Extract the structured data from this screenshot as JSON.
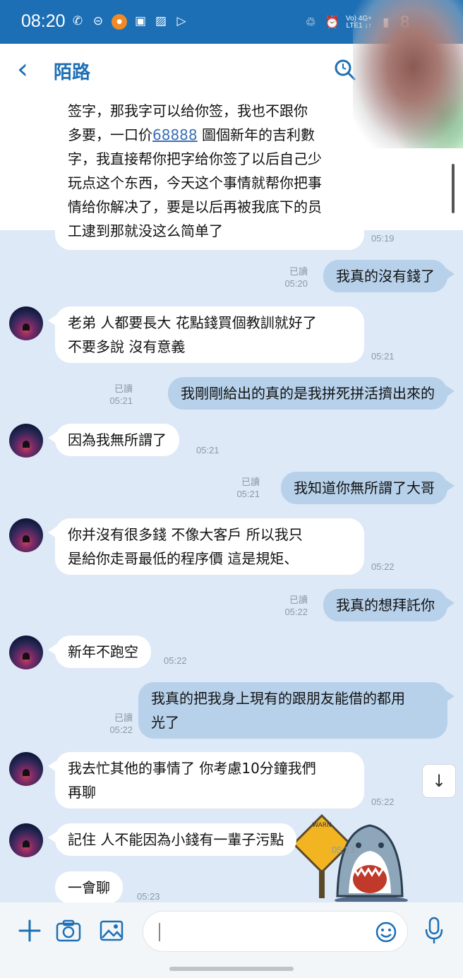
{
  "status_bar": {
    "time": "08:20",
    "net_top": "Vo) 4G+",
    "net_bottom": "LTE1 ↓↑",
    "battery": "8"
  },
  "header": {
    "title": "陌路"
  },
  "messages": [
    {
      "dir": "in",
      "text_lines": [
        "签字，那我字可以给你签，我也不跟你",
        "多要，一口价",
        "圖個新年的吉利數",
        "字，我直接帮你把字给你签了以后自己少",
        "玩点这个东西，今天这个事情就帮你把事",
        "情给你解决了，要是以后再被我底下的员",
        "工逮到那就没这么简单了"
      ],
      "link": "68888",
      "time": "05:19"
    },
    {
      "dir": "out",
      "text": "我真的沒有錢了",
      "read": "已讀",
      "time": "05:20"
    },
    {
      "dir": "in",
      "text_lines": [
        "老弟 人都要長大 花點錢買個教訓就好了",
        "不要多說 沒有意義"
      ],
      "time": "05:21"
    },
    {
      "dir": "out",
      "text": "我剛剛給出的真的是我拼死拼活擠出來的",
      "read": "已讀",
      "time": "05:21"
    },
    {
      "dir": "in",
      "text": "因為我無所謂了",
      "time": "05:21"
    },
    {
      "dir": "out",
      "text": "我知道你無所謂了大哥",
      "read": "已讀",
      "time": "05:21"
    },
    {
      "dir": "in",
      "text_lines": [
        "你并沒有很多錢  不像大客戶  所以我只",
        "是給你走哥最低的程序價  這是規矩、"
      ],
      "time": "05:22"
    },
    {
      "dir": "out",
      "text": "我真的想拜託你",
      "read": "已讀",
      "time": "05:22"
    },
    {
      "dir": "in",
      "text": "新年不跑空",
      "time": "05:22"
    },
    {
      "dir": "out",
      "text_lines": [
        "我真的把我身上現有的跟朋友能借的都用",
        "光了"
      ],
      "read": "已讀",
      "time": "05:22"
    },
    {
      "dir": "in",
      "text_lines": [
        "我去忙其他的事情了 你考慮10分鐘我們",
        "再聊"
      ],
      "time": "05:22"
    },
    {
      "dir": "in",
      "text": "記住  人不能因為小錢有一輩子污點",
      "time": "05:23"
    },
    {
      "dir": "in",
      "text": "一會聊",
      "time": "05:23"
    }
  ],
  "sticker": {
    "sign_text": "WARN",
    "icon": "shark-warning-sticker"
  },
  "icons": [
    "back-icon",
    "search-icon",
    "plus-icon",
    "camera-icon",
    "image-icon",
    "emoji-icon",
    "mic-icon",
    "scroll-down-icon"
  ],
  "colors": {
    "accent": "#1d6fb5",
    "chat_bg": "#dde9f6",
    "out_bubble": "#b7d1ea",
    "in_bubble": "#ffffff"
  }
}
